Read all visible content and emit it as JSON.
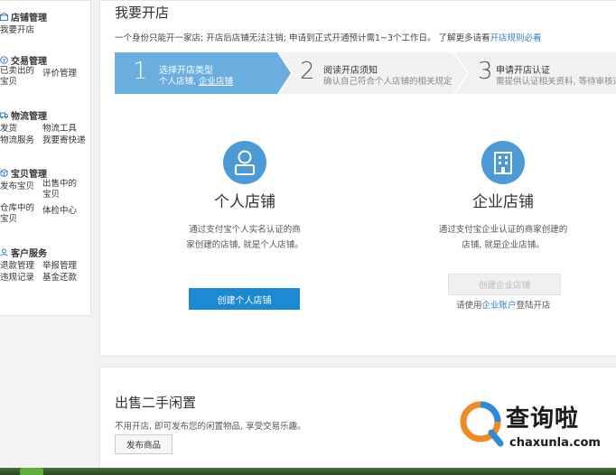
{
  "sidebar": {
    "groups": [
      {
        "title": "店铺管理",
        "icon": "shop-icon",
        "items": [
          "我要开店"
        ]
      },
      {
        "title": "交易管理",
        "icon": "trade-icon",
        "items": [
          "已卖出的宝贝",
          "评价管理"
        ]
      },
      {
        "title": "物流管理",
        "icon": "truck-icon",
        "items": [
          "发货",
          "物流工具",
          "物流服务",
          "我要寄快递"
        ]
      },
      {
        "title": "宝贝管理",
        "icon": "goods-icon",
        "items": [
          "发布宝贝",
          "出售中的宝贝",
          "仓库中的宝贝",
          "体检中心"
        ]
      },
      {
        "title": "客户服务",
        "icon": "service-icon",
        "items": [
          "退款管理",
          "举报管理",
          "违规记录",
          "基金还款"
        ]
      }
    ]
  },
  "main": {
    "title": "我要开店",
    "notice_text": "一个身份只能开一家店; 开店后店铺无法注销; 申请到正式开通预计需1~3个工作日。 了解更多请看",
    "notice_link": "开店规则必看",
    "steps": [
      {
        "num": "1",
        "title": "选择开店类型",
        "desc_prefix": "个人店铺, ",
        "desc_link": "企业店铺"
      },
      {
        "num": "2",
        "title": "阅读开店须知",
        "desc": "确认自己符合个人店铺的相关规定"
      },
      {
        "num": "3",
        "title": "申请开店认证",
        "desc": "需提供认证相关资料, 等待审核通"
      }
    ],
    "personal": {
      "name": "个人店铺",
      "desc": "通过支付宝个人实名认证的商家创建的店铺, 就是个人店铺。",
      "button": "创建个人店铺"
    },
    "enterprise": {
      "name": "企业店铺",
      "desc": "通过支付宝企业认证的商家创建的店铺, 就是企业店铺。",
      "button": "创建企业店铺",
      "hint_prefix": "请使用",
      "hint_link": "企业账户",
      "hint_suffix": "登陆开店"
    }
  },
  "secondhand": {
    "title": "出售二手闲置",
    "desc": "不用开店, 即可发布您的闲置物品, 享受交易乐趣。",
    "button": "发布商品"
  },
  "watermark": {
    "text": "查询啦",
    "url": "chaxunla.com"
  },
  "colors": {
    "accent": "#1c8ad3",
    "step_active": "#6aaee0",
    "link": "#2f7ecb",
    "icon_bg": "#4c9bd6"
  }
}
